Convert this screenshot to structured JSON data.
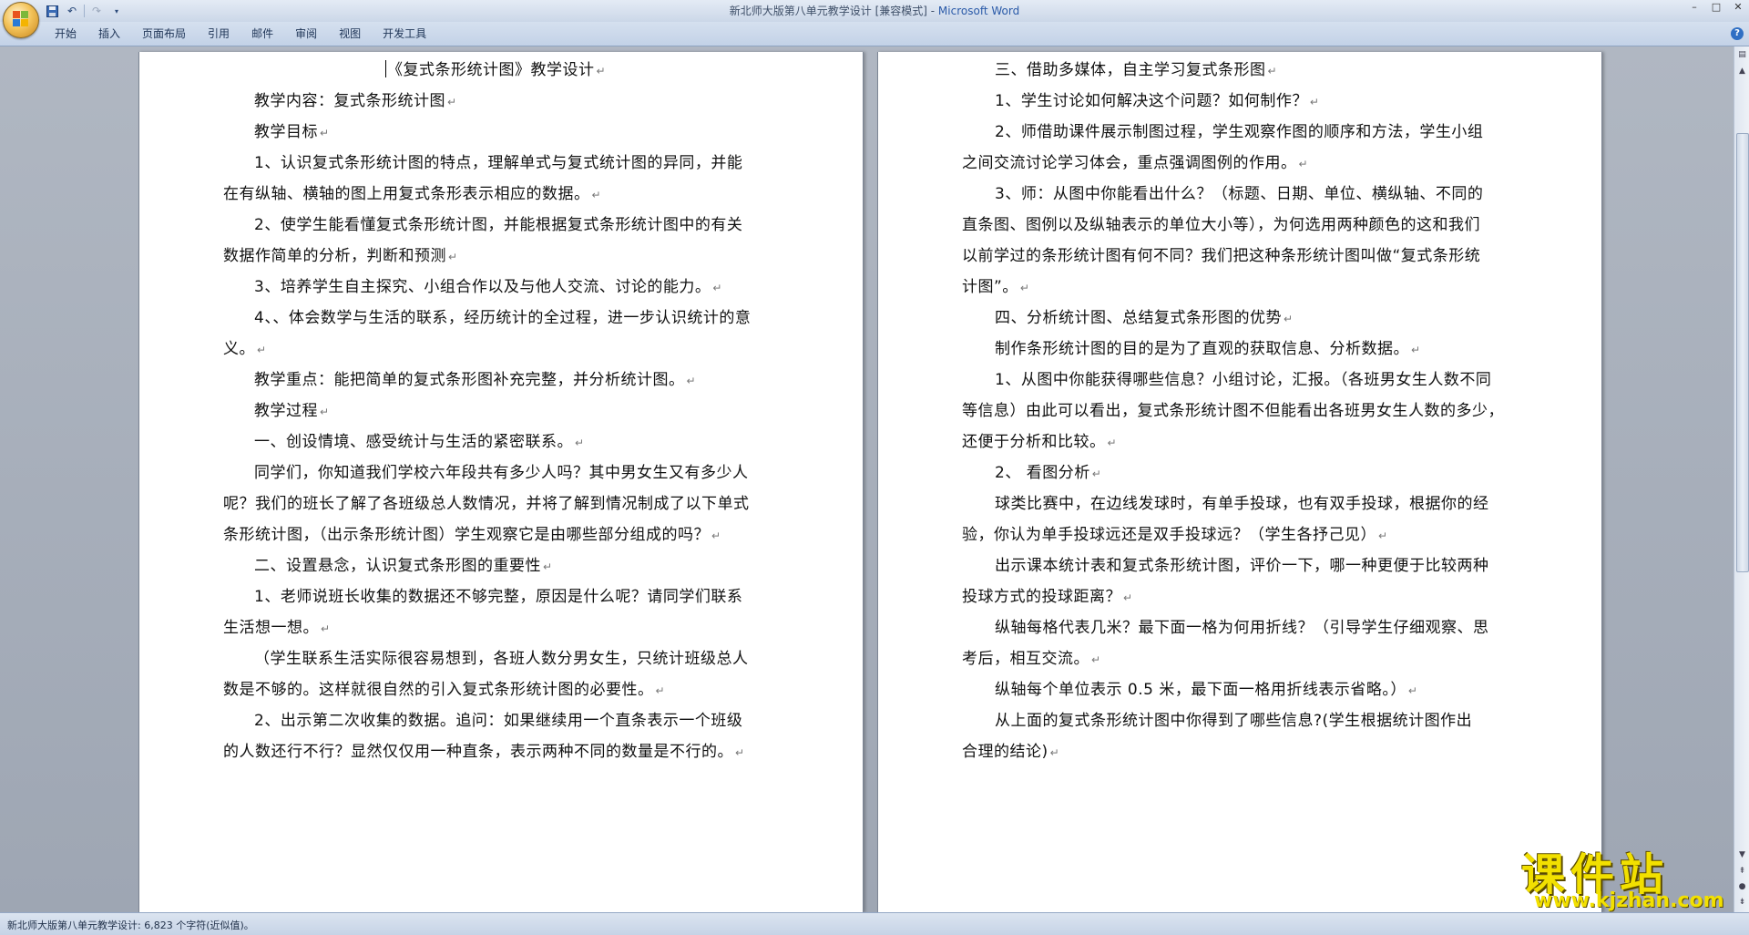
{
  "window": {
    "title": "新北师大版第八单元教学设计 [兼容模式] - ",
    "app_name": "Microsoft Word",
    "controls": [
      "–",
      "□",
      "✕"
    ]
  },
  "quick_access": [
    "save-icon",
    "undo-icon",
    "redo-icon",
    "customize-icon"
  ],
  "ribbon": {
    "tabs": [
      "开始",
      "插入",
      "页面布局",
      "引用",
      "邮件",
      "审阅",
      "视图",
      "开发工具"
    ],
    "help_label": "?"
  },
  "document": {
    "left_page": [
      "《复式条形统计图》教学设计",
      "教学内容：复式条形统计图",
      "教学目标",
      "1、认识复式条形统计图的特点，理解单式与复式统计图的异同，并能",
      "在有纵轴、横轴的图上用复式条形表示相应的数据。",
      "2、使学生能看懂复式条形统计图，并能根据复式条形统计图中的有关",
      "数据作简单的分析，判断和预测",
      "3、培养学生自主探究、小组合作以及与他人交流、讨论的能力。",
      "4、、体会数学与生活的联系，经历统计的全过程，进一步认识统计的意",
      "义。",
      "教学重点：能把简单的复式条形图补充完整，并分析统计图。",
      "教学过程",
      "一、创设情境、感受统计与生活的紧密联系。",
      "同学们，你知道我们学校六年段共有多少人吗？其中男女生又有多少人",
      "呢？我们的班长了解了各班级总人数情况，并将了解到情况制成了以下单式",
      "条形统计图，（出示条形统计图）学生观察它是由哪些部分组成的吗？",
      "二、设置悬念，认识复式条形图的重要性",
      "1、老师说班长收集的数据还不够完整，原因是什么呢？请同学们联系",
      "生活想一想。",
      "（学生联系生活实际很容易想到，各班人数分男女生，只统计班级总人",
      "数是不够的。这样就很自然的引入复式条形统计图的必要性。",
      "2、出示第二次收集的数据。追问：如果继续用一个直条表示一个班级",
      "的人数还行不行？显然仅仅用一种直条，表示两种不同的数量是不行的。"
    ],
    "right_page": [
      "三、借助多媒体，自主学习复式条形图",
      "1、学生讨论如何解决这个问题？如何制作？",
      "2、师借助课件展示制图过程，学生观察作图的顺序和方法，学生小组",
      "之间交流讨论学习体会，重点强调图例的作用。",
      "3、师：从图中你能看出什么？（标题、日期、单位、横纵轴、不同的",
      "直条图、图例以及纵轴表示的单位大小等），为何选用两种颜色的这和我们",
      "以前学过的条形统计图有何不同？我们把这种条形统计图叫做“复式条形统",
      "计图”。",
      "四、分析统计图、总结复式条形图的优势",
      "制作条形统计图的目的是为了直观的获取信息、分析数据。",
      "1、从图中你能获得哪些信息？小组讨论，汇报。（各班男女生人数不同",
      "等信息）由此可以看出，复式条形统计图不但能看出各班男女生人数的多少，",
      "还便于分析和比较。",
      "2、  看图分析",
      "球类比赛中，在边线发球时，有单手投球，也有双手投球，根据你的经",
      "验，你认为单手投球远还是双手投球远？（学生各抒己见）",
      "出示课本统计表和复式条形统计图，评价一下，哪一种更便于比较两种",
      "投球方式的投球距离？",
      "纵轴每格代表几米？最下面一格为何用折线？（引导学生仔细观察、思",
      "考后，相互交流。",
      "纵轴每个单位表示 0.5 米，最下面一格用折线表示省略。）",
      "从上面的复式条形统计图中你得到了哪些信息?(学生根据统计图作出",
      "合理的结论)"
    ]
  },
  "status": {
    "text": "新北师大版第八单元教学设计: 6,823 个字符(近似值)。"
  },
  "watermark": {
    "title": "课件站",
    "url": "www.kjzhan.com"
  }
}
